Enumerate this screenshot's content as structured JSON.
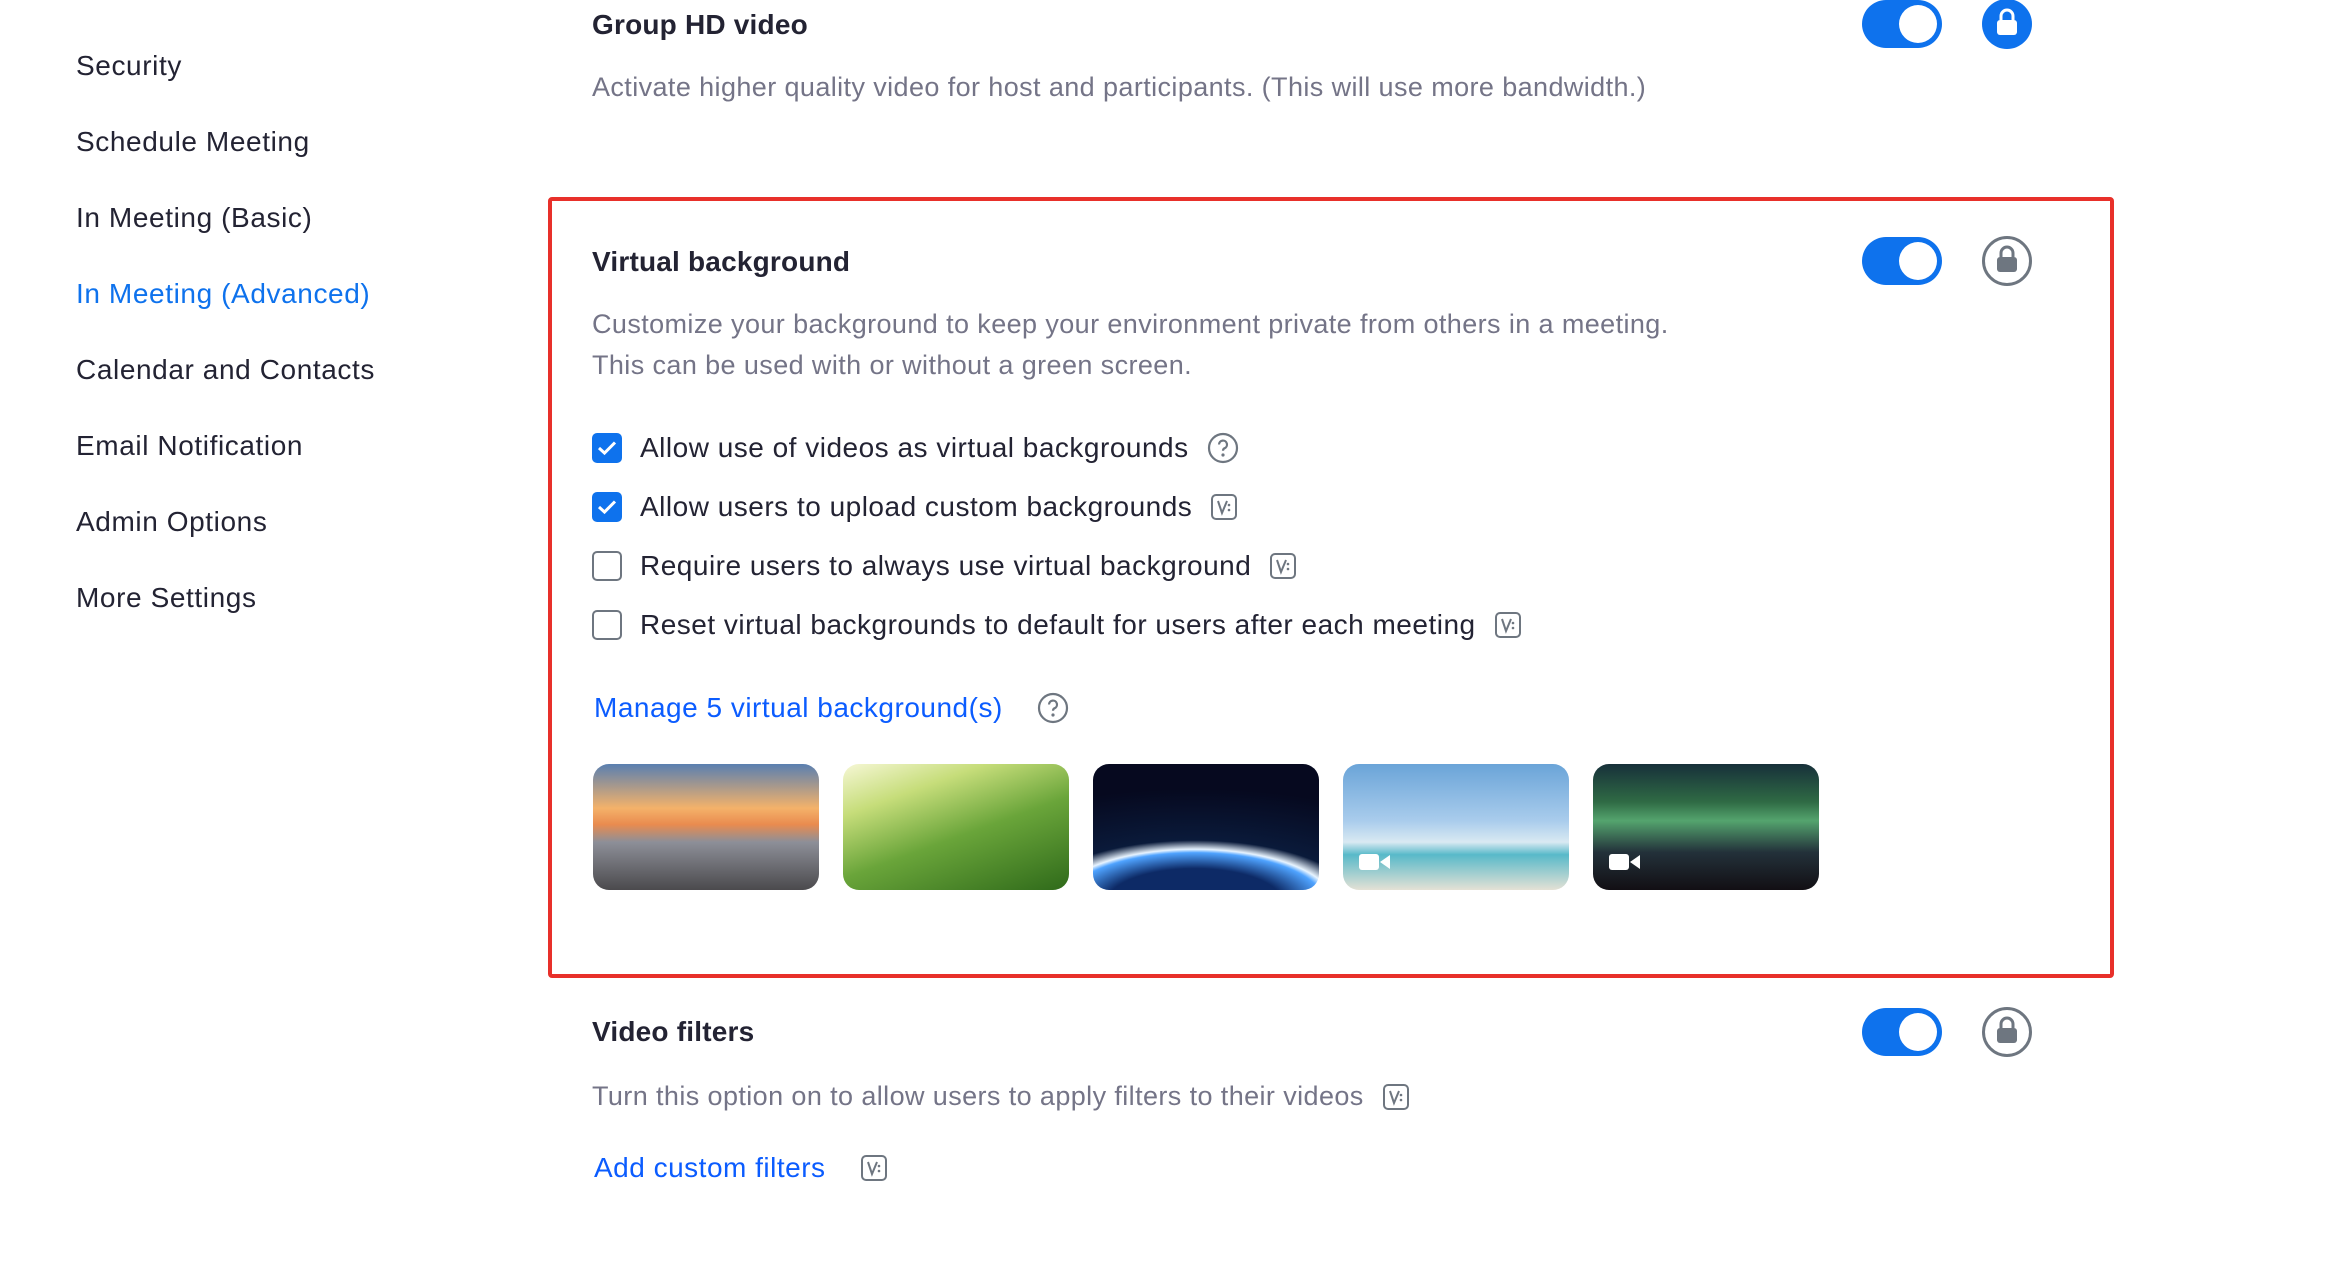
{
  "sidebar": {
    "items": [
      {
        "label": "Security",
        "active": false
      },
      {
        "label": "Schedule Meeting",
        "active": false
      },
      {
        "label": "In Meeting (Basic)",
        "active": false
      },
      {
        "label": "In Meeting (Advanced)",
        "active": true
      },
      {
        "label": "Calendar and Contacts",
        "active": false
      },
      {
        "label": "Email Notification",
        "active": false
      },
      {
        "label": "Admin Options",
        "active": false
      },
      {
        "label": "More Settings",
        "active": false
      }
    ]
  },
  "settings": {
    "group_hd_video": {
      "title": "Group HD video",
      "description": "Activate higher quality video for host and participants. (This will use more bandwidth.)",
      "enabled": true,
      "locked": true
    },
    "virtual_background": {
      "title": "Virtual background",
      "description_line1": "Customize your background to keep your environment private from others in a meeting.",
      "description_line2": "This can be used with or without a green screen.",
      "enabled": true,
      "locked": false,
      "options": [
        {
          "label": "Allow use of videos as virtual backgrounds",
          "checked": true,
          "icon": "help-icon"
        },
        {
          "label": "Allow users to upload custom backgrounds",
          "checked": true,
          "icon": "version-icon"
        },
        {
          "label": "Require users to always use virtual background",
          "checked": false,
          "icon": "version-icon"
        },
        {
          "label": "Reset virtual backgrounds to default for users after each meeting",
          "checked": false,
          "icon": "version-icon"
        }
      ],
      "manage_link": "Manage 5 virtual background(s)",
      "backgrounds": [
        {
          "name": "golden-gate-bridge",
          "video": false
        },
        {
          "name": "grass",
          "video": false
        },
        {
          "name": "earth-from-space",
          "video": false
        },
        {
          "name": "beach-palm-tree",
          "video": true
        },
        {
          "name": "northern-lights",
          "video": true
        }
      ]
    },
    "video_filters": {
      "title": "Video filters",
      "description": "Turn this option on to allow users to apply filters to their videos",
      "enabled": true,
      "locked": false,
      "add_link": "Add custom filters"
    }
  },
  "colors": {
    "accent": "#0e72ed",
    "link": "#0b5cff",
    "highlight": "#e8302a",
    "muted_text": "#747487"
  }
}
